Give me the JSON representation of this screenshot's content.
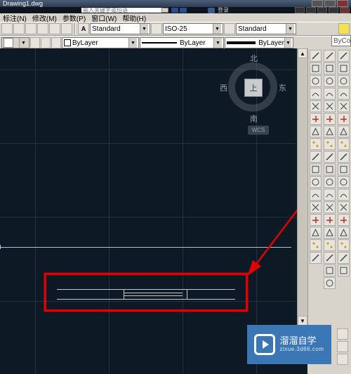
{
  "title": "Drawing1.dwg",
  "search_placeholder": "输入关键字或短语",
  "login_label": "登录",
  "menubar": [
    "标注(N)",
    "修改(M)",
    "参数(P)",
    "窗口(W)",
    "帮助(H)"
  ],
  "toolbars": {
    "row1": {
      "text_style": "Standard",
      "dim_style": "ISO-25",
      "dropdown_style": "Standard"
    },
    "row2": {
      "layer": "ByLayer",
      "linetype": "ByLayer",
      "lineweight": "ByLayer",
      "bycol": "ByCol"
    }
  },
  "viewcube": {
    "n": "北",
    "s": "南",
    "e": "东",
    "w": "西",
    "face": "上",
    "wcs": "WCS"
  },
  "brand": {
    "name": "溜溜自学",
    "url": "zixue.3d66.com"
  },
  "right_tools_left": [
    "line",
    "cline",
    "pline",
    "poly",
    "rect",
    "arc",
    "circ",
    "spline",
    "ell",
    "ell2",
    "pt",
    "hatch",
    "grad",
    "region",
    "table",
    "text",
    "ins"
  ],
  "right_tools_mid": [
    "crop",
    "dyn",
    "del",
    "copy",
    "mir",
    "off",
    "arr",
    "move",
    "rot",
    "scale",
    "str",
    "trim",
    "ext",
    "brk",
    "brk2",
    "join",
    "cham",
    "fil",
    "expl"
  ],
  "right_tools_right": [
    "tmp",
    "snap",
    "end",
    "mid",
    "int",
    "app",
    "ext2",
    "cen",
    "qua",
    "tan",
    "perp",
    "par",
    "ins2",
    "node",
    "near",
    "none",
    "osn",
    "brush"
  ]
}
